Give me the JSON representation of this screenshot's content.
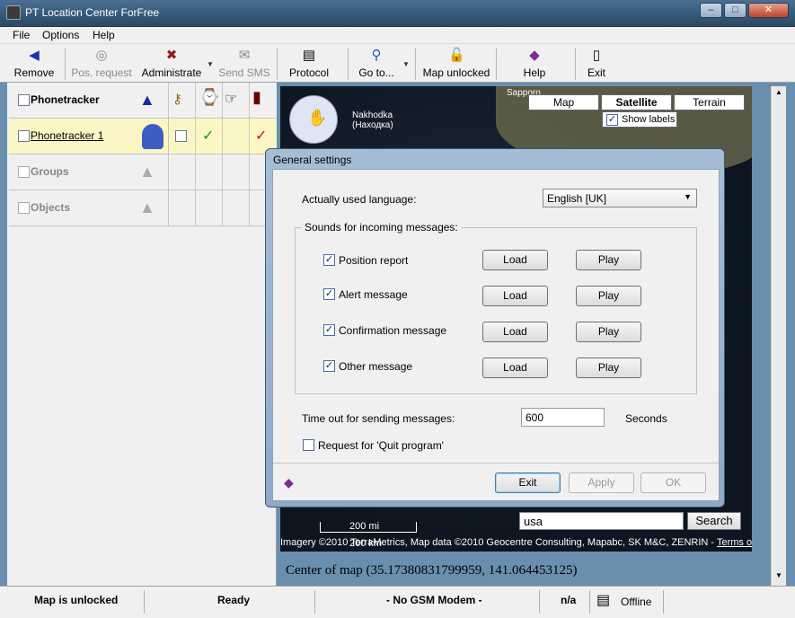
{
  "window": {
    "title": "PT Location Center ForFree",
    "min": "–",
    "max": "□",
    "close": "✕"
  },
  "menu": [
    "File",
    "Options",
    "Help"
  ],
  "toolbar": {
    "remove": "Remove",
    "pos_request": "Pos. request",
    "administrate": "Administrate",
    "send_sms": "Send SMS",
    "protocol": "Protocol",
    "goto": "Go to...",
    "map_unlocked": "Map unlocked",
    "help": "Help",
    "exit": "Exit"
  },
  "tree": {
    "phonetracker": "Phonetracker",
    "phonetracker1": "Phonetracker 1",
    "groups": "Groups",
    "objects": "Objects"
  },
  "map": {
    "type_map": "Map",
    "type_satellite": "Satellite",
    "type_terrain": "Terrain",
    "show_labels": "Show labels",
    "place1": "Sapporo",
    "place2": "Nakhodka",
    "place3": "(Находка)",
    "search_value": "usa",
    "search_btn": "Search",
    "scale": "200 mi",
    "scale2": "200 km",
    "attribution": "Imagery ©2010 TerraMetrics, Map data ©2010 Geocentre Consulting, Mapabc, SK M&C, ZENRIN - ",
    "terms": "Terms of Use"
  },
  "center": "Center of map (35.17380831799959, 141.064453125)",
  "status": {
    "map": "Map is unlocked",
    "ready": "Ready",
    "gsm": "- No GSM Modem -",
    "na": "n/a",
    "offline": "Offline"
  },
  "dialog": {
    "title": "General settings",
    "lang_label": "Actually used language:",
    "lang_value": "English [UK]",
    "sounds_group": "Sounds for incoming messages:",
    "sounds": [
      {
        "label": "Position report"
      },
      {
        "label": "Alert message"
      },
      {
        "label": "Confirmation message"
      },
      {
        "label": "Other message"
      }
    ],
    "load": "Load",
    "play": "Play",
    "timeout_label": "Time out for sending messages:",
    "timeout_value": "600",
    "seconds": "Seconds",
    "quit_label": "Request for 'Quit program'",
    "exit": "Exit",
    "apply": "Apply",
    "ok": "OK"
  }
}
